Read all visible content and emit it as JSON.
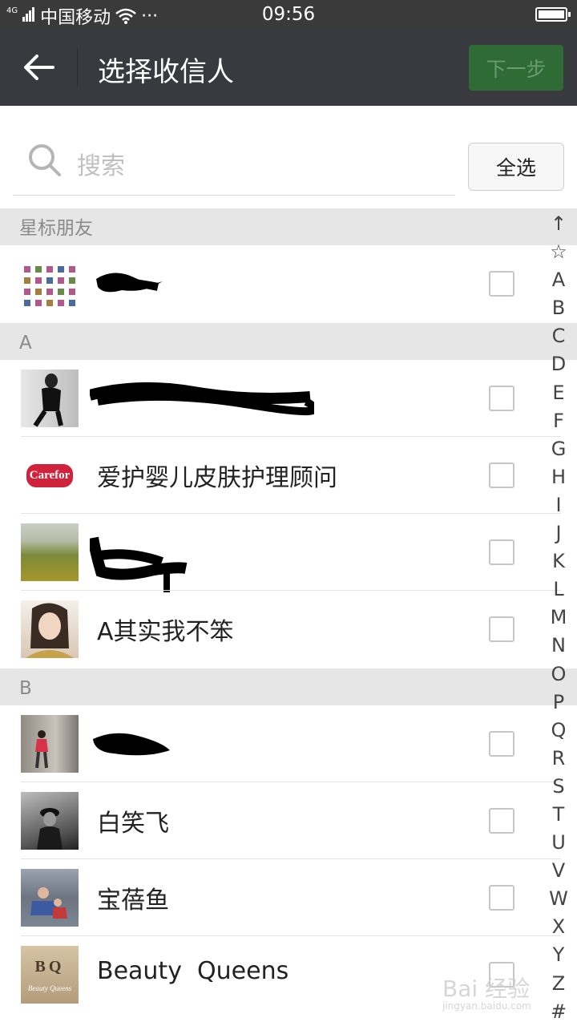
{
  "status": {
    "carrier": "中国移动",
    "network": "4G",
    "dots": "···",
    "time": "09:56"
  },
  "nav": {
    "title": "选择收信人",
    "next_label": "下一步"
  },
  "search": {
    "placeholder": "搜索",
    "select_all_label": "全选"
  },
  "sections": [
    {
      "header": "星标朋友",
      "contacts": [
        {
          "name": "",
          "redacted": true,
          "avatar": "sticker-grid"
        }
      ]
    },
    {
      "header": "A",
      "contacts": [
        {
          "name": "",
          "redacted": true,
          "avatar": "dark-person"
        },
        {
          "name": "爱护婴儿皮肤护理顾问",
          "redacted": false,
          "avatar": "carefor-logo",
          "logo_text": "Carefor"
        },
        {
          "name": "",
          "redacted": true,
          "avatar": "landscape"
        },
        {
          "name": "A其实我不笨",
          "redacted": false,
          "avatar": "girl-portrait"
        }
      ]
    },
    {
      "header": "B",
      "contacts": [
        {
          "name": "",
          "redacted": true,
          "avatar": "street-photo"
        },
        {
          "name": "白笑飞",
          "redacted": false,
          "avatar": "bw-photo"
        },
        {
          "name": "宝蓓鱼",
          "redacted": false,
          "avatar": "kids-photo"
        },
        {
          "name": "Beauty  Queens",
          "redacted": false,
          "avatar": "bq-logo",
          "logo_text": "BQ",
          "logo_subtext": "Beauty Queens"
        }
      ]
    }
  ],
  "index_letters": [
    "↑",
    "☆",
    "A",
    "B",
    "C",
    "D",
    "E",
    "F",
    "G",
    "H",
    "I",
    "J",
    "K",
    "L",
    "M",
    "N",
    "O",
    "P",
    "Q",
    "R",
    "S",
    "T",
    "U",
    "V",
    "W",
    "X",
    "Y",
    "Z",
    "#"
  ],
  "watermark": {
    "text": "Bai 经验",
    "sub": "jingyan.baidu.com"
  },
  "colors": {
    "nav_bg": "#393a3f",
    "accent_green": "#2e6b35",
    "section_bg": "#e6e6e6"
  }
}
